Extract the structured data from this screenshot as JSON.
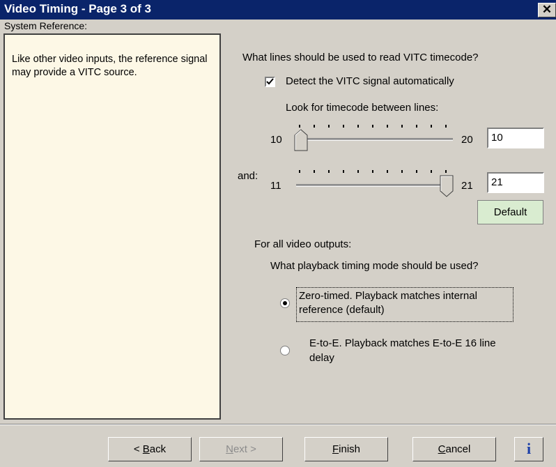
{
  "window": {
    "title": "Video Timing - Page 3 of 3",
    "close_glyph": "✕"
  },
  "sidebar": {
    "label": "System Reference:",
    "text": "Like other video inputs, the reference signal may provide a VITC source."
  },
  "vitc": {
    "question": "What lines should be used to read VITC timecode?",
    "auto_detect_label": "Detect the VITC signal automatically",
    "auto_detect_checked": true,
    "range_label": "Look for timecode between lines:",
    "slider1": {
      "min_label": "10",
      "max_label": "20",
      "value": "10"
    },
    "and_label": "and:",
    "slider2": {
      "min_label": "11",
      "max_label": "21",
      "value": "21"
    },
    "default_button": "Default"
  },
  "outputs": {
    "heading": "For all video outputs:",
    "question": "What playback timing mode should be used?",
    "options": [
      {
        "line1": "Zero-timed. Playback matches internal",
        "line2": "reference (default)",
        "selected": true
      },
      {
        "line1": "E-to-E. Playback matches E-to-E 16 line",
        "line2": "delay",
        "selected": false
      }
    ]
  },
  "buttons": {
    "back": {
      "accel": "B",
      "rest": "ack",
      "prefix": "< "
    },
    "next": {
      "accel": "N",
      "rest": "ext >"
    },
    "finish": {
      "accel": "F",
      "rest": "inish"
    },
    "cancel": {
      "accel": "C",
      "rest": "ancel"
    },
    "info": "i"
  }
}
